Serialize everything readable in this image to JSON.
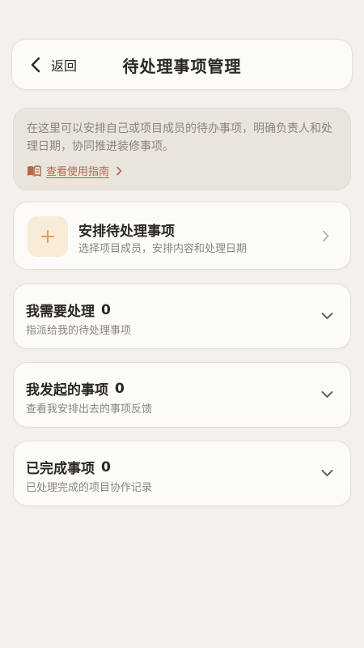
{
  "header": {
    "back_label": "返回",
    "title": "待处理事项管理"
  },
  "intro": {
    "text": "在这里可以安排自己或项目成员的待办事项，明确负责人和处理日期，协同推进装修事项。",
    "guide_link": "查看使用指南"
  },
  "add_card": {
    "title": "安排待处理事项",
    "subtitle": "选择项目成员，安排内容和处理日期"
  },
  "sections": [
    {
      "title": "我需要处理",
      "count": "0",
      "subtitle": "指派给我的待处理事项"
    },
    {
      "title": "我发起的事项",
      "count": "0",
      "subtitle": "查看我安排出去的事项反馈"
    },
    {
      "title": "已完成事项",
      "count": "0",
      "subtitle": "已处理完成的项目协作记录"
    }
  ],
  "colors": {
    "background": "#f4f1ec",
    "card": "#fdfbf7",
    "accent": "#b4674a",
    "plus": "#d9a24e",
    "plus_bg": "#f8ecd6"
  },
  "icons": {
    "back": "chevron-left-icon",
    "guide": "book-icon",
    "add": "plus-icon",
    "expand": "chevron-down-icon",
    "forward": "chevron-right-icon"
  }
}
